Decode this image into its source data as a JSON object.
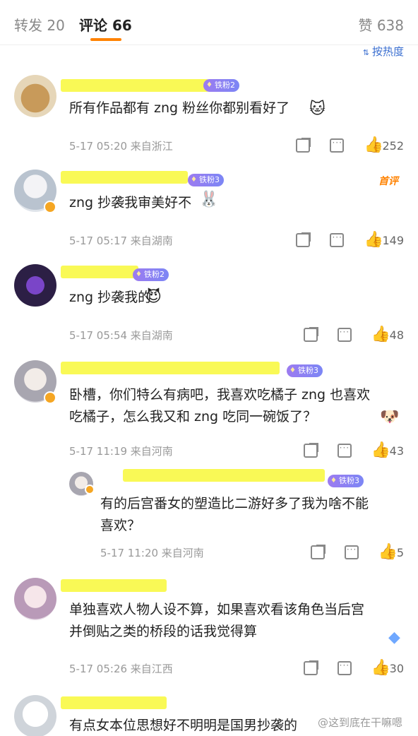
{
  "tabs": {
    "repost": "转发 20",
    "comment": "评论 66",
    "like": "赞 638"
  },
  "sort": {
    "label": "按热度",
    "icon": "sort-arrows-icon"
  },
  "comments": [
    {
      "fan_badge": "铁粉2",
      "text": "所有作品都有 zng 粉丝你都别看好了",
      "meta": "5-17 05:20  来自浙江",
      "likes": "252"
    },
    {
      "fan_badge": "铁粉3",
      "top_tag": "首评",
      "text": "zng 抄袭我审美好不",
      "meta": "5-17 05:17  来自湖南",
      "likes": "149"
    },
    {
      "fan_badge": "铁粉2",
      "text": "zng 抄袭我的",
      "meta": "5-17 05:54  来自湖南",
      "likes": "48"
    },
    {
      "fan_badge": "铁粉3",
      "text_line1": "卧槽，你们特么有病吧，我喜欢吃橘子 zng 也喜欢",
      "text_line2": "吃橘子，怎么我又和 zng 吃同一碗饭了？",
      "meta": "5-17 11:19  来自河南",
      "likes": "43"
    },
    {
      "fan_badge": "铁粉3",
      "text_line1": "有的后宫番女的塑造比二游好多了我为啥不能",
      "text_line2": "喜欢？",
      "meta": "5-17 11:20  来自河南",
      "likes": "5"
    },
    {
      "text_line1": "单独喜欢人物人设不算，如果喜欢看该角色当后宫",
      "text_line2": "并倒贴之类的桥段的话我觉得算",
      "meta": "5-17 05:26  来自江西",
      "likes": "30"
    },
    {
      "text": "有点女本位思想好不明明是国男抄袭的"
    }
  ],
  "watermark": "@这到底在干嘛嗯"
}
